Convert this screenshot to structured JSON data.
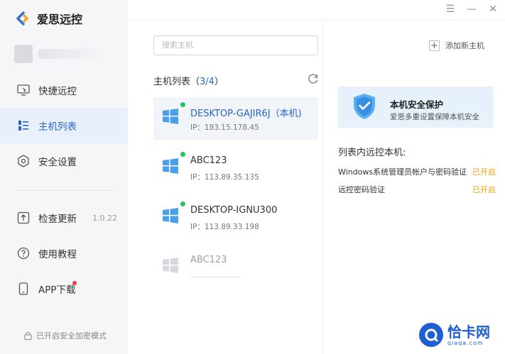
{
  "app": {
    "title": "爱思远控"
  },
  "window_controls": {
    "menu": "☰",
    "minimize": "—",
    "close": "✕"
  },
  "sidebar": {
    "items": [
      {
        "label": "快捷远控",
        "icon": "remote-screen-icon"
      },
      {
        "label": "主机列表",
        "icon": "host-list-icon",
        "active": true
      },
      {
        "label": "安全设置",
        "icon": "shield-hex-icon"
      },
      {
        "label": "检查更新",
        "icon": "upload-icon",
        "version": "1.0.22"
      },
      {
        "label": "使用教程",
        "icon": "help-icon"
      },
      {
        "label": "APP下载",
        "icon": "phone-icon",
        "badge": true
      }
    ],
    "footer": "已开启安全加密模式"
  },
  "search": {
    "placeholder": "搜索主机"
  },
  "host_list": {
    "title_prefix": "主机列表（",
    "count": "3/4",
    "title_suffix": "）",
    "hosts": [
      {
        "name": "DESKTOP-GAJIR6J（本机)",
        "ip": "IP：183.15.178.45",
        "online": true,
        "active": true
      },
      {
        "name": "ABC123",
        "ip": "IP：113.89.35.135",
        "online": true
      },
      {
        "name": "DESKTOP-IGNU300",
        "ip": "IP：113.89.33.198",
        "online": true
      },
      {
        "name": "ABC123",
        "ip": "",
        "online": false
      }
    ]
  },
  "add_host": {
    "label": "添加新主机"
  },
  "security_card": {
    "title": "本机安全保护",
    "subtitle": "爱思多重设置保障本机安全"
  },
  "remote_control": {
    "title": "列表内远控本机:",
    "rows": [
      {
        "label": "Windows系统管理员帐户与密码验证",
        "status": "已开启"
      },
      {
        "label": "远控密码验证",
        "status": "已开启"
      }
    ]
  },
  "watermark": {
    "main": "恰卡网",
    "sub": "qiaqa.com"
  },
  "colors": {
    "accent": "#2766c7",
    "online": "#22c55e",
    "status_on": "#f2a20c",
    "badge": "#f23b3b"
  }
}
